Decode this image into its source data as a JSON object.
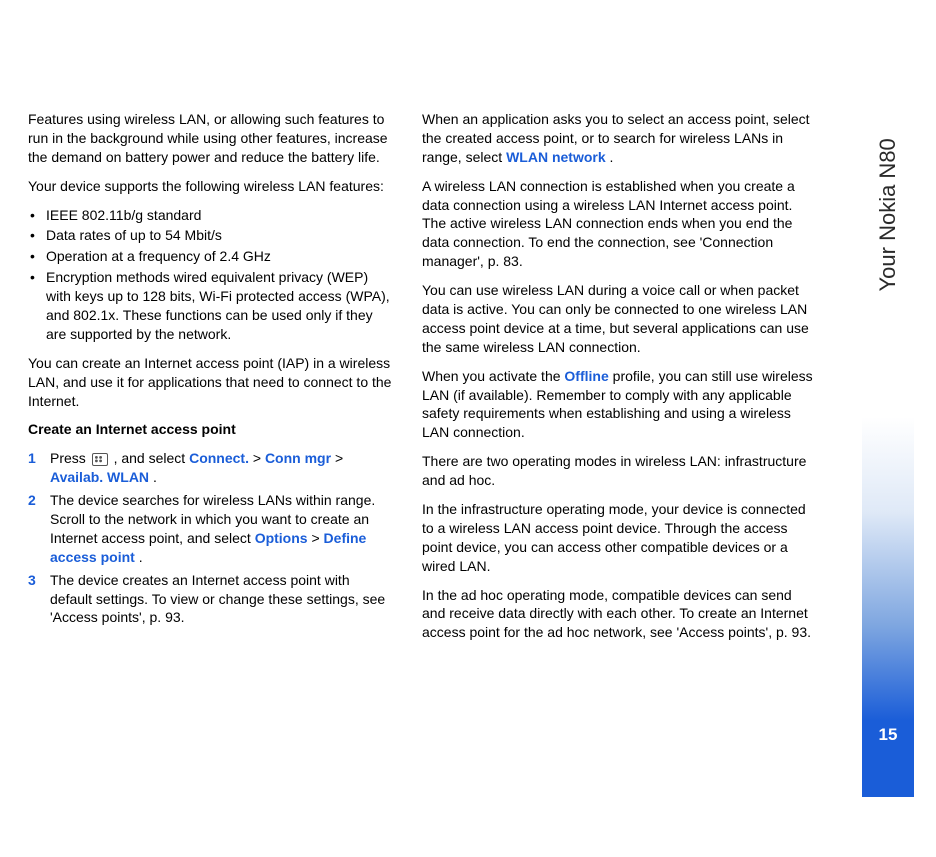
{
  "sidebar": {
    "title": "Your Nokia N80",
    "page_number": "15"
  },
  "left": {
    "p1": "Features using wireless LAN, or allowing such features to run in the background while using other features, increase the demand on battery power and reduce the battery life.",
    "p2": "Your device supports the following wireless LAN features:",
    "bullets": {
      "b1": "IEEE 802.11b/g standard",
      "b2": "Data rates of up to 54 Mbit/s",
      "b3": "Operation at a frequency of 2.4 GHz",
      "b4": "Encryption methods wired equivalent privacy (WEP) with keys up to 128 bits, Wi-Fi protected access (WPA), and 802.1x. These functions can be used only if they are supported by the network."
    },
    "p3": "You can create an Internet access point (IAP) in a wireless LAN, and use it for applications that need to connect to the Internet.",
    "h1": "Create an Internet access point",
    "step1": {
      "pre": "Press ",
      "mid": " , and select ",
      "l1": "Connect.",
      "s1": " > ",
      "l2": "Conn mgr",
      "s2": " > ",
      "l3": "Availab. WLAN",
      "post": "."
    },
    "step2": {
      "pre": "The device searches for wireless LANs within range. Scroll to the network in which you want to create an Internet access point, and select ",
      "l1": "Options",
      "s1": " > ",
      "l2": "Define access point",
      "post": "."
    },
    "step3": "The device creates an Internet access point with default settings. To view or change these settings, see 'Access points', p. 93."
  },
  "right": {
    "p1": {
      "pre": "When an application asks you to select an access point, select the created access point, or to search for wireless LANs in range, select ",
      "l1": "WLAN network",
      "post": "."
    },
    "p2": "A wireless LAN connection is established when you create a data connection using a wireless LAN Internet access point. The active wireless LAN connection ends when you end the data connection. To end the connection, see 'Connection manager', p. 83.",
    "p3": "You can use wireless LAN during a voice call or when packet data is active. You can only be connected to one wireless LAN access point device at a time, but several applications can use the same wireless LAN connection.",
    "p4": {
      "pre": "When you activate the ",
      "l1": "Offline",
      "post": " profile, you can still use wireless LAN (if available). Remember to comply with any applicable safety requirements when establishing and using a wireless LAN connection."
    },
    "p5": "There are two operating modes in wireless LAN: infrastructure and ad hoc.",
    "p6": "In the infrastructure operating mode, your device is connected to a wireless LAN access point device. Through the access point device, you can access other compatible devices or a wired LAN.",
    "p7": "In the ad hoc operating mode, compatible devices can send and receive data directly with each other. To create an Internet access point for the ad hoc network, see 'Access points', p. 93."
  }
}
